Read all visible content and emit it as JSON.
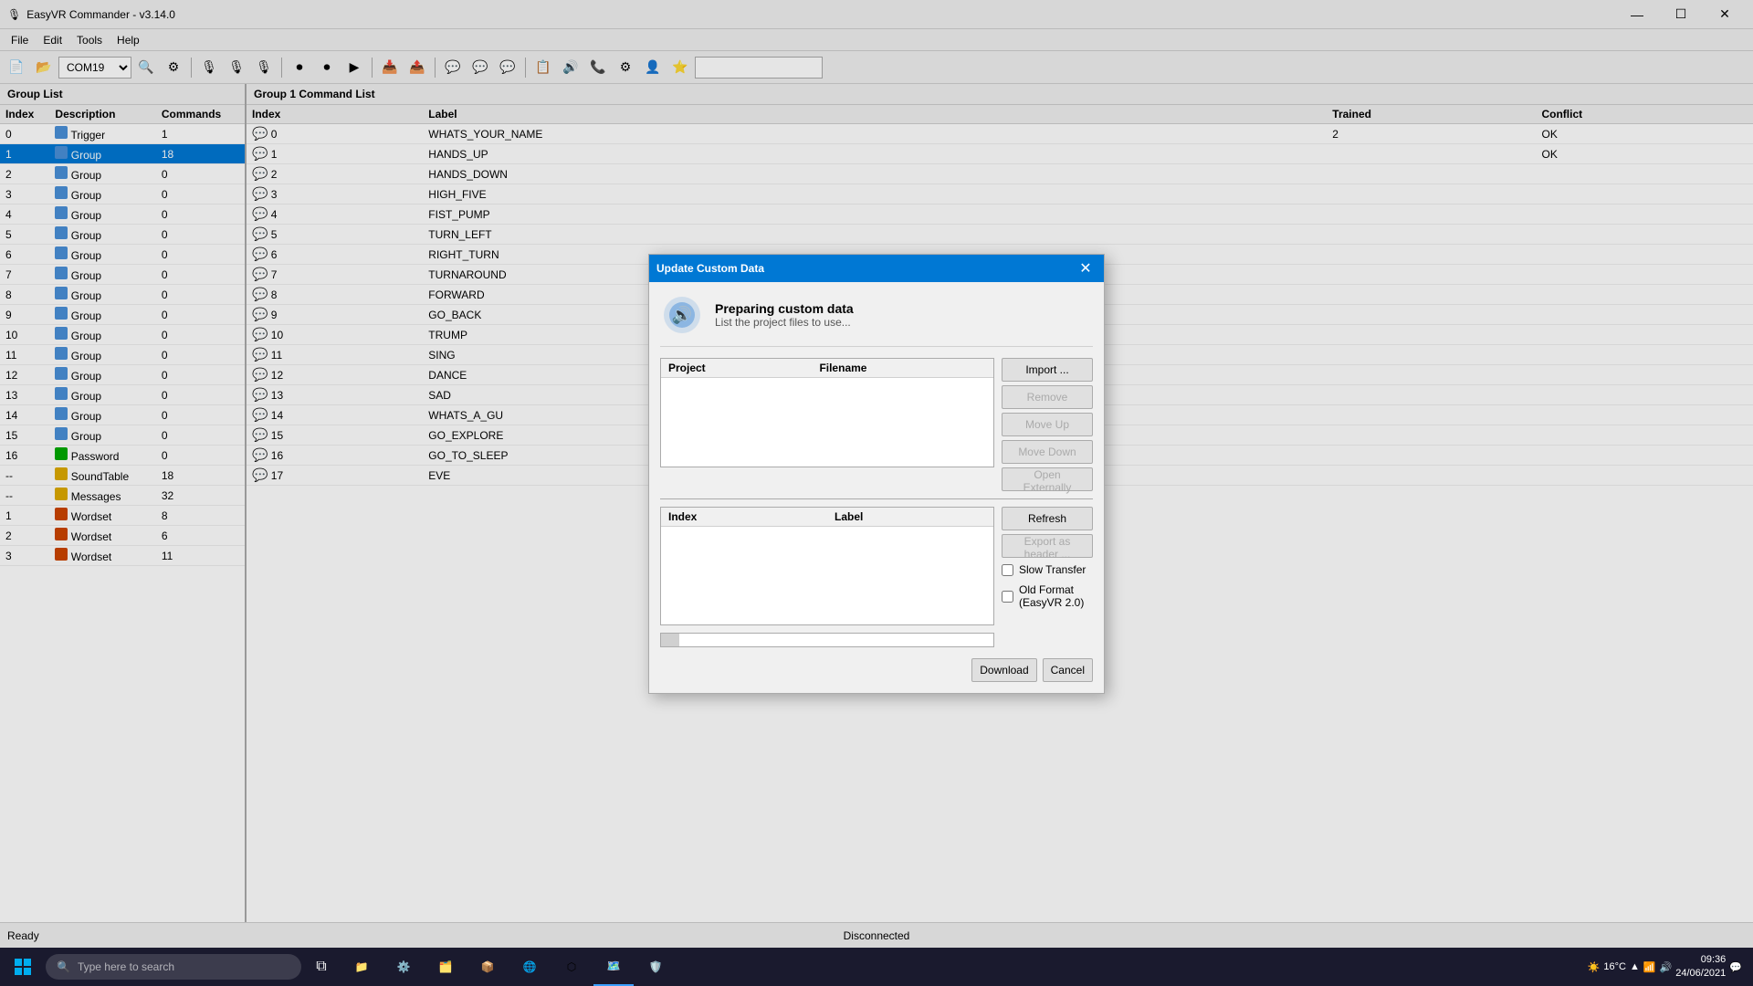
{
  "app": {
    "title": "EasyVR Commander - v3.14.0",
    "com_port": "COM19",
    "status_left": "Ready",
    "status_center": "Disconnected"
  },
  "menu": {
    "items": [
      "File",
      "Edit",
      "Tools",
      "Help"
    ]
  },
  "group_list": {
    "header": "Group List",
    "columns": [
      "Index",
      "Description",
      "Commands"
    ],
    "rows": [
      {
        "index": "0",
        "description": "Trigger",
        "commands": "1",
        "type": "trigger",
        "color": "#4a90d9"
      },
      {
        "index": "1",
        "description": "Group",
        "commands": "18",
        "type": "group_selected",
        "color": "#4a90d9"
      },
      {
        "index": "2",
        "description": "Group",
        "commands": "0",
        "type": "group",
        "color": "#4a90d9"
      },
      {
        "index": "3",
        "description": "Group",
        "commands": "0",
        "type": "group",
        "color": "#4a90d9"
      },
      {
        "index": "4",
        "description": "Group",
        "commands": "0",
        "type": "group",
        "color": "#4a90d9"
      },
      {
        "index": "5",
        "description": "Group",
        "commands": "0",
        "type": "group",
        "color": "#4a90d9"
      },
      {
        "index": "6",
        "description": "Group",
        "commands": "0",
        "type": "group",
        "color": "#4a90d9"
      },
      {
        "index": "7",
        "description": "Group",
        "commands": "0",
        "type": "group",
        "color": "#4a90d9"
      },
      {
        "index": "8",
        "description": "Group",
        "commands": "0",
        "type": "group",
        "color": "#4a90d9"
      },
      {
        "index": "9",
        "description": "Group",
        "commands": "0",
        "type": "group",
        "color": "#4a90d9"
      },
      {
        "index": "10",
        "description": "Group",
        "commands": "0",
        "type": "group",
        "color": "#4a90d9"
      },
      {
        "index": "11",
        "description": "Group",
        "commands": "0",
        "type": "group",
        "color": "#4a90d9"
      },
      {
        "index": "12",
        "description": "Group",
        "commands": "0",
        "type": "group",
        "color": "#4a90d9"
      },
      {
        "index": "13",
        "description": "Group",
        "commands": "0",
        "type": "group",
        "color": "#4a90d9"
      },
      {
        "index": "14",
        "description": "Group",
        "commands": "0",
        "type": "group",
        "color": "#4a90d9"
      },
      {
        "index": "15",
        "description": "Group",
        "commands": "0",
        "type": "group",
        "color": "#4a90d9"
      },
      {
        "index": "16",
        "description": "Password",
        "commands": "0",
        "type": "password",
        "color": "#00aa00"
      },
      {
        "index": "--",
        "description": "SoundTable",
        "commands": "18",
        "type": "soundtable",
        "color": "#ddaa00"
      },
      {
        "index": "--",
        "description": "Messages",
        "commands": "32",
        "type": "messages",
        "color": "#ddaa00"
      },
      {
        "index": "1",
        "description": "Wordset",
        "commands": "8",
        "type": "wordset",
        "color": "#cc4400"
      },
      {
        "index": "2",
        "description": "Wordset",
        "commands": "6",
        "type": "wordset",
        "color": "#cc4400"
      },
      {
        "index": "3",
        "description": "Wordset",
        "commands": "11",
        "type": "wordset",
        "color": "#cc4400"
      }
    ]
  },
  "command_list": {
    "header": "Group 1 Command List",
    "columns": [
      "Index",
      "Label",
      "Trained",
      "Conflict"
    ],
    "rows": [
      {
        "index": "0",
        "label": "WHATS_YOUR_NAME",
        "trained": "2",
        "conflict": "OK"
      },
      {
        "index": "1",
        "label": "HANDS_UP",
        "trained": "",
        "conflict": "OK"
      },
      {
        "index": "2",
        "label": "HANDS_DOWN",
        "trained": "",
        "conflict": ""
      },
      {
        "index": "3",
        "label": "HIGH_FIVE",
        "trained": "",
        "conflict": ""
      },
      {
        "index": "4",
        "label": "FIST_PUMP",
        "trained": "",
        "conflict": ""
      },
      {
        "index": "5",
        "label": "TURN_LEFT",
        "trained": "",
        "conflict": ""
      },
      {
        "index": "6",
        "label": "RIGHT_TURN",
        "trained": "",
        "conflict": ""
      },
      {
        "index": "7",
        "label": "TURNAROUND",
        "trained": "",
        "conflict": ""
      },
      {
        "index": "8",
        "label": "FORWARD",
        "trained": "",
        "conflict": ""
      },
      {
        "index": "9",
        "label": "GO_BACK",
        "trained": "",
        "conflict": ""
      },
      {
        "index": "10",
        "label": "TRUMP",
        "trained": "",
        "conflict": ""
      },
      {
        "index": "11",
        "label": "SING",
        "trained": "",
        "conflict": ""
      },
      {
        "index": "12",
        "label": "DANCE",
        "trained": "",
        "conflict": ""
      },
      {
        "index": "13",
        "label": "SAD",
        "trained": "",
        "conflict": ""
      },
      {
        "index": "14",
        "label": "WHATS_A_GU",
        "trained": "",
        "conflict": ""
      },
      {
        "index": "15",
        "label": "GO_EXPLORE",
        "trained": "",
        "conflict": ""
      },
      {
        "index": "16",
        "label": "GO_TO_SLEEP",
        "trained": "",
        "conflict": ""
      },
      {
        "index": "17",
        "label": "EVE",
        "trained": "",
        "conflict": ""
      }
    ]
  },
  "dialog": {
    "title": "Update Custom Data",
    "header_title": "Preparing custom data",
    "header_subtitle": "List the project files to use...",
    "top_table_columns": [
      "Project",
      "Filename"
    ],
    "bottom_table_columns": [
      "Index",
      "Label"
    ],
    "buttons": {
      "import": "Import ...",
      "remove": "Remove",
      "move_up": "Move Up",
      "move_down": "Move Down",
      "open_externally": "Open Externally",
      "refresh": "Refresh",
      "export_as_header": "Export as header ...",
      "download": "Download",
      "cancel": "Cancel"
    },
    "checkboxes": {
      "slow_transfer": "Slow Transfer",
      "old_format": "Old Format (EasyVR 2.0)"
    }
  },
  "taskbar": {
    "search_placeholder": "Type here to search",
    "time": "09:36",
    "date": "24/06/2021",
    "temperature": "16°C"
  }
}
